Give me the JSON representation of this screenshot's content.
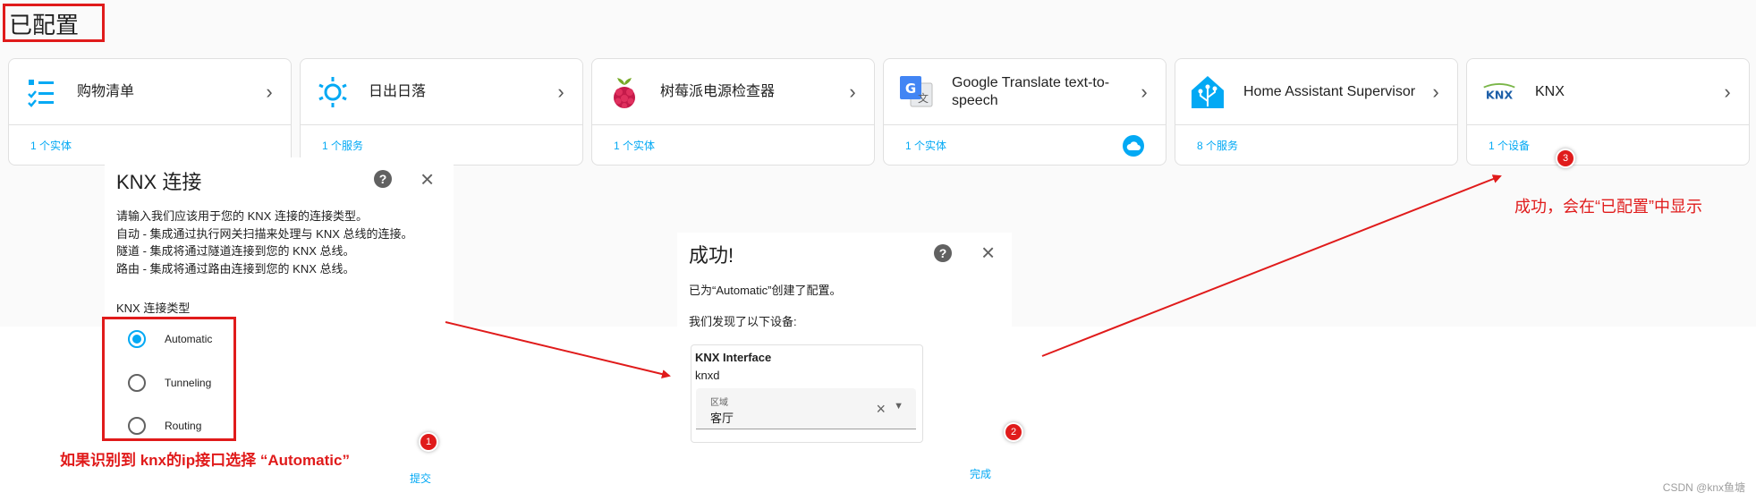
{
  "section_title": "已配置",
  "integrations": [
    {
      "name": "购物清单",
      "icon": "checklist-icon",
      "link": "1 个实体"
    },
    {
      "name": "日出日落",
      "icon": "sun-icon",
      "link": "1 个服务"
    },
    {
      "name": "树莓派电源检查器",
      "icon": "raspberry-pi-icon",
      "link": "1 个实体"
    },
    {
      "name": "Google Translate text-to-speech",
      "icon": "google-translate-icon",
      "link": "1 个实体"
    },
    {
      "name": "Home Assistant Supervisor",
      "icon": "home-assistant-icon",
      "link": "8 个服务"
    },
    {
      "name": "KNX",
      "icon": "knx-logo-icon",
      "link": "1 个设备"
    }
  ],
  "knx_dialog": {
    "title": "KNX 连接",
    "description": [
      "请输入我们应该用于您的 KNX 连接的连接类型。",
      "自动 - 集成通过执行网关扫描来处理与 KNX 总线的连接。",
      "隧道 - 集成将通过隧道连接到您的 KNX 总线。",
      "路由 - 集成将通过路由连接到您的 KNX 总线。"
    ],
    "field_label": "KNX 连接类型",
    "options": [
      "Automatic",
      "Tunneling",
      "Routing"
    ],
    "selected": "Automatic",
    "submit": "提交"
  },
  "success_dialog": {
    "title": "成功!",
    "created_text": "已为“Automatic”创建了配置。",
    "found_text": "我们发现了以下设备:",
    "device_name": "KNX Interface",
    "device_model": "knxd",
    "area_label": "区域",
    "area_value": "客厅",
    "finish": "完成"
  },
  "annotations": {
    "note_1": "如果识别到 knx的ip接口选择 “Automatic”",
    "note_3": "成功，会在“已配置”中显示",
    "badge_1": "1",
    "badge_2": "2",
    "badge_3": "3"
  },
  "watermark": "CSDN @knx鱼塘",
  "colors": {
    "accent": "#03a9f4",
    "annotation_red": "#e01b1b"
  }
}
